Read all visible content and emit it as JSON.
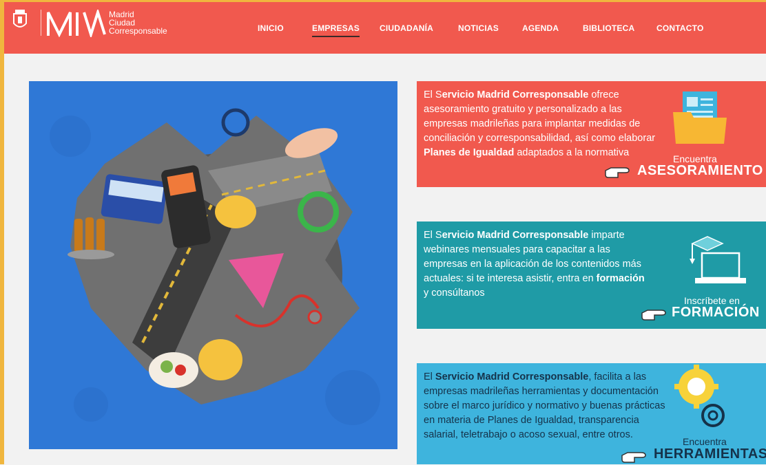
{
  "brand": {
    "logo_line1": "Madrid",
    "logo_line2": "Ciudad",
    "logo_line3": "Corresponsable",
    "logo_mark": "MIV",
    "color_header": "#f1594e"
  },
  "nav": {
    "items": [
      "INICIO",
      "EMPRESAS",
      "CIUDADANÍA",
      "NOTICIAS",
      "AGENDA",
      "BIBLIOTECA",
      "CONTACTO"
    ],
    "active": "EMPRESAS"
  },
  "cards": [
    {
      "pre": "El S",
      "strong": "ervicio Madrid Corresponsable",
      "mid": " ofrece asesoramiento gratuito y personalizado a las empresas madrileñas para implantar medidas de conciliación y corresponsabilidad, así como elaborar ",
      "strong2": "Planes de Igualdad",
      "post": " adaptados a la normativa",
      "cta_small": "Encuentra",
      "cta_big": "ASESORAMIENTO",
      "icon": "folder-document-icon",
      "color": "#f1594e"
    },
    {
      "pre": "El S",
      "strong": "ervicio Madrid Corresponsable",
      "mid": " imparte webinares mensuales para capacitar a las empresas en la aplicación de los contenidos más actuales: si te interesa asistir, entra en ",
      "strong2": "formación",
      "post": " y consúltanos",
      "cta_small": "Inscríbete en",
      "cta_big": "FORMACIÓN",
      "icon": "laptop-graduation-cap-icon",
      "color": "#1f9ba6"
    },
    {
      "pre": "El ",
      "strong": "Servicio Madrid Corresponsable",
      "mid": ", facilita a las empresas madrileñas herramientas y documentación sobre el marco jurídico y normativo y buenas prácticas en materia de Planes de Igualdad, transparencia salarial, teletrabajo o acoso sexual, entre otros.",
      "strong2": "",
      "post": "",
      "cta_small": "Encuentra",
      "cta_big": "HERRAMIENTAS",
      "icon": "gears-icon",
      "color": "#3eb4dd"
    }
  ]
}
